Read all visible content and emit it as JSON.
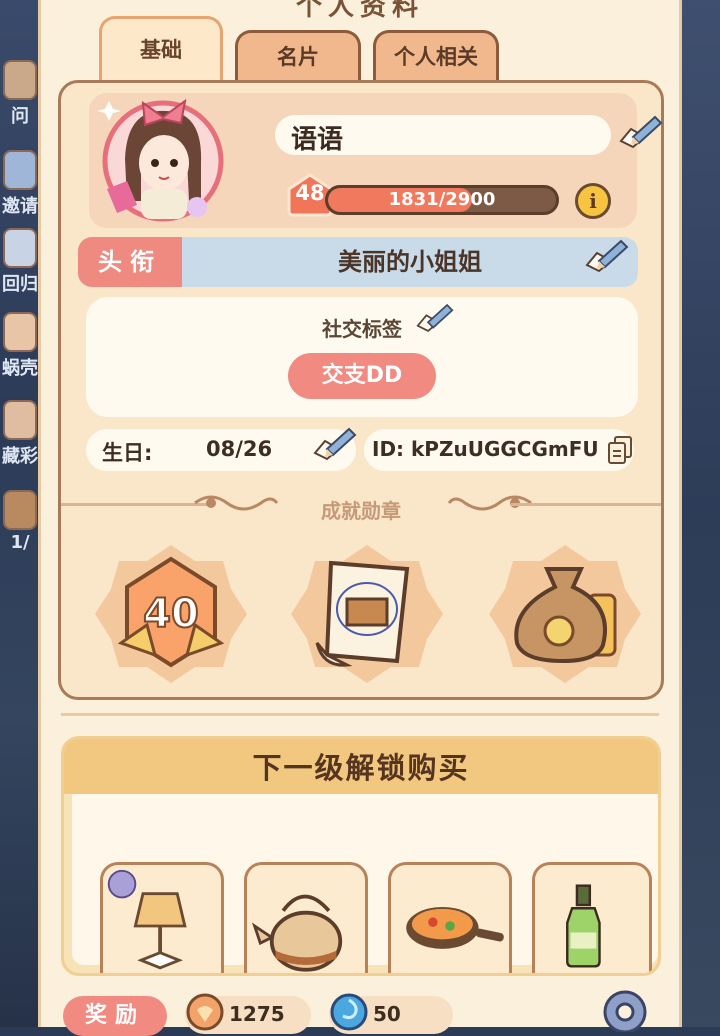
{
  "page": {
    "title": "个人资料"
  },
  "tabs": [
    {
      "label": "基础",
      "active": true
    },
    {
      "label": "名片",
      "active": false
    },
    {
      "label": "个人相关",
      "active": false
    }
  ],
  "side_menu": [
    {
      "label": "问",
      "icon": "quest-icon"
    },
    {
      "label": "邀请",
      "icon": "invite-icon"
    },
    {
      "label": "回归",
      "icon": "cat-icon"
    },
    {
      "label": "蜗壳",
      "icon": "snail-icon"
    },
    {
      "label": "藏彩",
      "icon": "bunny-icon"
    },
    {
      "label": "1/",
      "icon": "chest-icon"
    }
  ],
  "profile": {
    "name": "语语",
    "level": "48",
    "xp_text": "1831/2900",
    "xp_fraction": 0.631,
    "info_icon_glyph": "i"
  },
  "title_row": {
    "label": "头衔",
    "value": "美丽的小姐姐"
  },
  "social": {
    "label": "社交标签",
    "tag": "交支DD"
  },
  "birthday": {
    "label": "生日:",
    "value": "08/26"
  },
  "id": {
    "text": "ID: kPZuUGGCGmFU"
  },
  "achievements": {
    "title": "成就勋章",
    "badges": [
      {
        "name": "level-40-badge",
        "text": "40"
      },
      {
        "name": "scroll-box-badge"
      },
      {
        "name": "money-bag-badge"
      }
    ]
  },
  "unlock": {
    "title": "下一级解锁购买",
    "items": [
      {
        "name": "lamp-item",
        "icon": "lamp-icon"
      },
      {
        "name": "teapot-item",
        "icon": "teapot-icon"
      },
      {
        "name": "frying-pan-item",
        "icon": "pan-icon"
      },
      {
        "name": "bottle-item",
        "icon": "bottle-icon"
      }
    ]
  },
  "footer": {
    "reward_label": "奖励",
    "currencies": [
      {
        "icon": "coin-icon",
        "value": "1275"
      },
      {
        "icon": "blue-gem-icon",
        "value": "50"
      }
    ]
  },
  "colors": {
    "panel": "#fbf0dc",
    "accent": "#f18a80",
    "card_border": "#a97a57",
    "title_bar": "#c9dbe9"
  }
}
